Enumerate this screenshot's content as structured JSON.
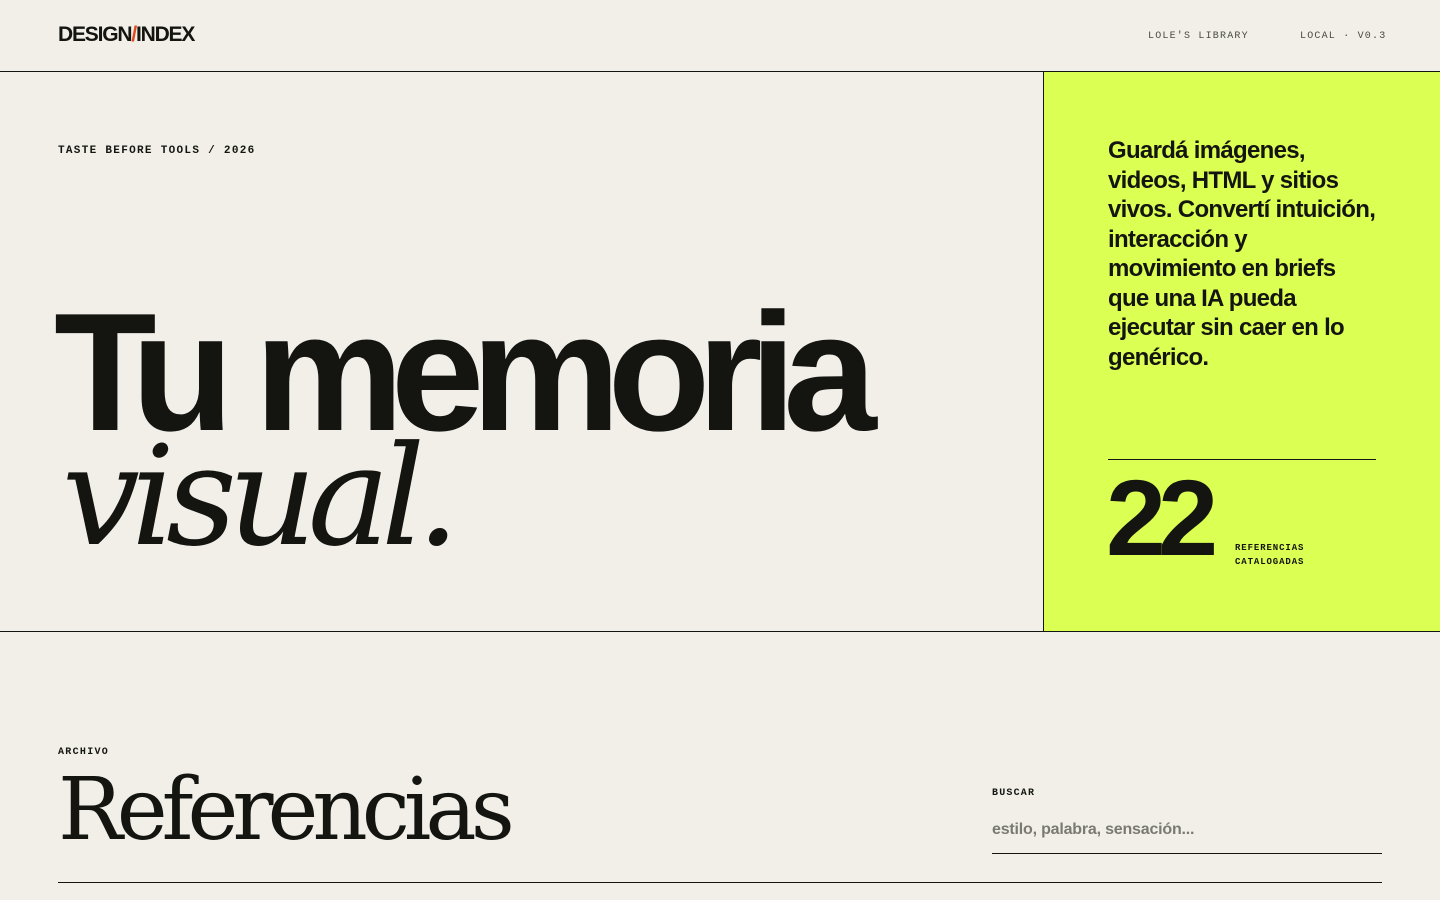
{
  "header": {
    "logo_left": "DESIGN",
    "logo_slash": "/",
    "logo_right": "INDEX",
    "nav_library": "LOLE'S LIBRARY",
    "nav_version": "LOCAL · V0.3"
  },
  "hero": {
    "eyebrow": "TASTE BEFORE TOOLS / 2026",
    "title_line1": "Tu memoria",
    "title_line2": "visual.",
    "description": "Guardá imágenes, videos, HTML y sitios vivos. Convertí intuición, interacción y movimiento en briefs que una IA pueda ejecutar sin caer en lo genérico.",
    "stat_number": "22",
    "stat_label_line1": "REFERENCIAS",
    "stat_label_line2": "CATALOGADAS"
  },
  "archive": {
    "eyebrow": "ARCHIVO",
    "title": "Referencias",
    "search_label": "BUSCAR",
    "search_placeholder": "estilo, palabra, sensación...",
    "search_value": ""
  },
  "colors": {
    "background": "#f1efe8",
    "ink": "#141410",
    "accent_lime": "#dbff52",
    "logo_slash": "#e04a1f"
  }
}
